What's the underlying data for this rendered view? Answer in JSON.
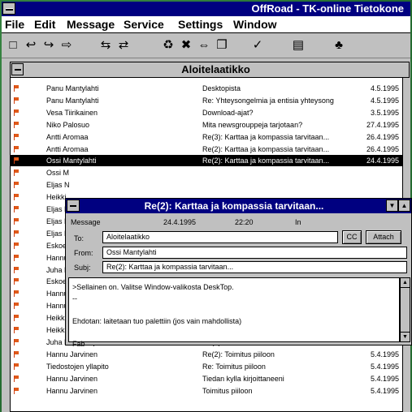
{
  "app": {
    "title": "OffRoad - TK-online Tietokone"
  },
  "menu": [
    "File",
    "Edit",
    "Message",
    "Service",
    "Settings",
    "Window"
  ],
  "toolbar_icons": [
    "new-doc-icon",
    "reply-icon",
    "forward-icon",
    "send-icon",
    "receive-icon",
    "print-icon",
    "cut-icon",
    "insert-icon",
    "copy-icon",
    "mark-icon",
    "save-icon",
    "address-icon"
  ],
  "list": {
    "title": "Aloitelaatikko",
    "rows": [
      {
        "from": "Panu Mantylahti",
        "subject": "Desktopista",
        "date": "4.5.1995"
      },
      {
        "from": "Panu Mantylahti",
        "subject": "Re: Yhteysongelmia ja entisia yhteysong",
        "date": "4.5.1995"
      },
      {
        "from": "Vesa Tiirikainen",
        "subject": "Download-ajat?",
        "date": "3.5.1995"
      },
      {
        "from": "Niko Palosuo",
        "subject": "Mita newsgrouppeja tarjotaan?",
        "date": "27.4.1995"
      },
      {
        "from": "Antti Aromaa",
        "subject": "Re(3): Karttaa ja kompassia tarvitaan...",
        "date": "26.4.1995"
      },
      {
        "from": "Antti Aromaa",
        "subject": "Re(2): Karttaa ja kompassia tarvitaan...",
        "date": "26.4.1995"
      },
      {
        "from": "Ossi Mantylahti",
        "subject": "Re(2): Karttaa ja kompassia tarvitaan...",
        "date": "24.4.1995"
      },
      {
        "from": "Ossi M",
        "subject": "",
        "date": ""
      },
      {
        "from": "Eljas N",
        "subject": "",
        "date": ""
      },
      {
        "from": "Heikki",
        "subject": "",
        "date": ""
      },
      {
        "from": "Eljas N",
        "subject": "",
        "date": ""
      },
      {
        "from": "Eljas N",
        "subject": "",
        "date": ""
      },
      {
        "from": "Eljas N",
        "subject": "",
        "date": ""
      },
      {
        "from": "Eskoe",
        "subject": "",
        "date": ""
      },
      {
        "from": "Hannu",
        "subject": "",
        "date": ""
      },
      {
        "from": "Juha K",
        "subject": "",
        "date": ""
      },
      {
        "from": "Eskoe",
        "subject": "",
        "date": ""
      },
      {
        "from": "Hannu",
        "subject": "",
        "date": ""
      },
      {
        "from": "Hannu",
        "subject": "",
        "date": ""
      },
      {
        "from": "Heikki",
        "subject": "",
        "date": ""
      },
      {
        "from": "Heikki",
        "subject": "",
        "date": ""
      },
      {
        "from": "Juha Kankaanpaa",
        "subject": "Re(3): Purkin nimeksi Tietonet",
        "date": "6.4.1995"
      },
      {
        "from": "Hannu Jarvinen",
        "subject": "Re(2): Toimitus piiloon",
        "date": "5.4.1995"
      },
      {
        "from": "Tiedostojen yllapito",
        "subject": "Re: Toimitus piiloon",
        "date": "5.4.1995"
      },
      {
        "from": "Hannu Jarvinen",
        "subject": "Tiedan kylla kirjoittaneeni",
        "date": "5.4.1995"
      },
      {
        "from": "Hannu Jarvinen",
        "subject": "Toimitus piiloon",
        "date": "5.4.1995"
      }
    ]
  },
  "message": {
    "title": "Re(2): Karttaa ja kompassia tarvitaan...",
    "label": "Message",
    "date": "24.4.1995",
    "time": "22:20",
    "folder": "In",
    "to_label": "To:",
    "to": "Aloitelaatikko",
    "from_label": "From:",
    "from": "Ossi Mantylahti",
    "subj_label": "Subj:",
    "subj": "Re(2): Karttaa ja kompassia tarvitaan...",
    "cc_button": "CC",
    "attach_button": "Attach",
    "body": [
      ">Sellainen on. Valitse Window-valikosta DeskTop.",
      "--",
      "",
      "Ehdotan: laitetaan tuo palettiin (jos vain mahdollista)",
      "",
      "Fab"
    ]
  }
}
